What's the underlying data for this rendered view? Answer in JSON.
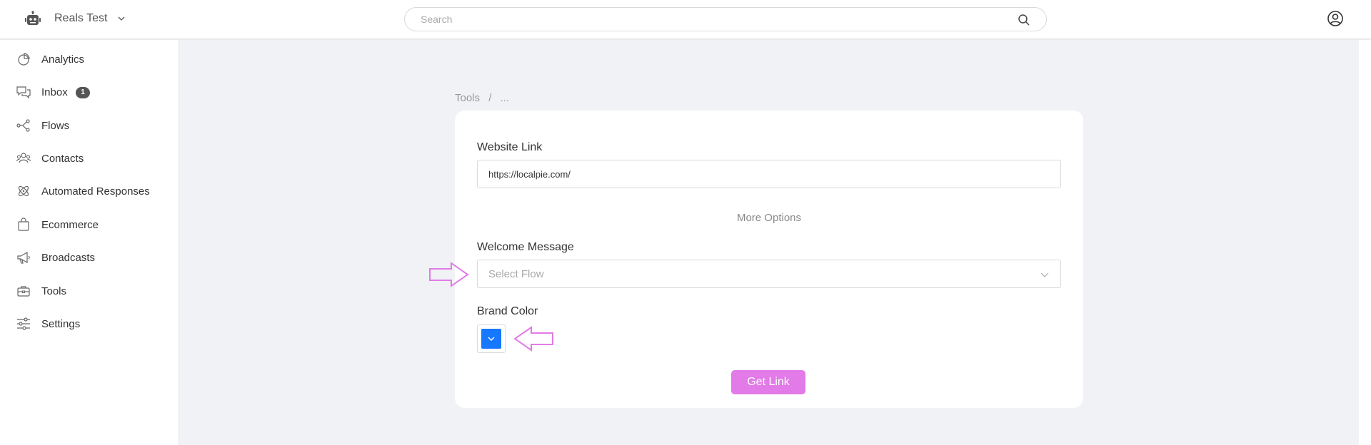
{
  "header": {
    "workspace_name": "Reals Test",
    "search_placeholder": "Search"
  },
  "sidebar": {
    "items": [
      {
        "label": "Analytics",
        "icon": "pie-chart-icon"
      },
      {
        "label": "Inbox",
        "icon": "chat-icon",
        "badge": "1"
      },
      {
        "label": "Flows",
        "icon": "flow-icon"
      },
      {
        "label": "Contacts",
        "icon": "contacts-icon"
      },
      {
        "label": "Automated Responses",
        "icon": "atom-icon"
      },
      {
        "label": "Ecommerce",
        "icon": "shopping-bag-icon"
      },
      {
        "label": "Broadcasts",
        "icon": "megaphone-icon"
      },
      {
        "label": "Tools",
        "icon": "toolbox-icon"
      },
      {
        "label": "Settings",
        "icon": "sliders-icon"
      }
    ]
  },
  "breadcrumb": {
    "root": "Tools",
    "separator": "/",
    "current": "..."
  },
  "form": {
    "website_link_label": "Website Link",
    "website_link_value": "https://localpie.com/",
    "more_options_label": "More Options",
    "welcome_message_label": "Welcome Message",
    "welcome_message_placeholder": "Select Flow",
    "brand_color_label": "Brand Color",
    "brand_color_value": "#1677ff",
    "get_link_label": "Get Link"
  },
  "colors": {
    "accent": "#e27ae8",
    "annotation_arrow": "#e27ae8"
  }
}
